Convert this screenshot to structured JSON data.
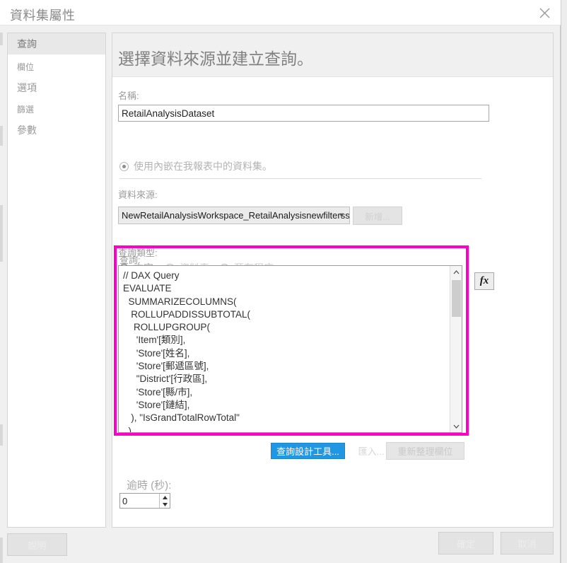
{
  "window": {
    "title": "資料集屬性",
    "close_icon": "close-icon"
  },
  "sidebar": {
    "items": [
      {
        "label": "查詢",
        "selected": true
      },
      {
        "label": "欄位",
        "selected": false
      },
      {
        "label": "選項",
        "selected": false
      },
      {
        "label": "篩選",
        "selected": false
      },
      {
        "label": "參數",
        "selected": false
      }
    ]
  },
  "main": {
    "heading": "選擇資料來源並建立查詢。",
    "name": {
      "label": "名稱:",
      "value": "RetailAnalysisDataset"
    },
    "embedded_radio": {
      "label": "使用內嵌在我報表中的資料集。",
      "selected": true
    },
    "datasource": {
      "label": "資料來源:",
      "value": "NewRetailAnalysisWorkspace_RetailAnalysisnewfilterssl",
      "chevron": "▼",
      "add_button": "新增..."
    },
    "query_type": {
      "label": "查詢類型:",
      "options": [
        {
          "label": "文字",
          "selected": true
        },
        {
          "label": "資料表",
          "selected": false
        },
        {
          "label": "預存程序",
          "selected": false
        }
      ]
    },
    "query": {
      "label": "查詢:",
      "text": "// DAX Query\nEVALUATE\n  SUMMARIZECOLUMNS(\n   ROLLUPADDISSUBTOTAL(\n    ROLLUPGROUP(\n     'Item'[類別],\n     'Store'[姓名],\n     'Store'[郵遞區號],\n     \"District'[行政區],\n     'Store'[縣/市],\n     'Store'[鏈結],\n   ), \"IsGrandTotalRowTotal\"\n  ),\n   \"This_Year_Sales\", 'Sales'[This Year Sales]",
      "fx_button": "fx",
      "scroll_up": "˄",
      "scroll_down": "˅"
    },
    "actions": {
      "query_designer": "查詢設計工具...",
      "import": "匯入...",
      "refresh_fields": "重新整理欄位"
    },
    "timeout": {
      "label": "逾時 (秒):",
      "value": "0",
      "spin_up": "▲",
      "spin_down": "▼"
    }
  },
  "footer": {
    "help": "說明",
    "ok": "確定",
    "cancel": "取消"
  },
  "colors": {
    "highlight": "#ff00c8",
    "accent": "#2196e3"
  }
}
